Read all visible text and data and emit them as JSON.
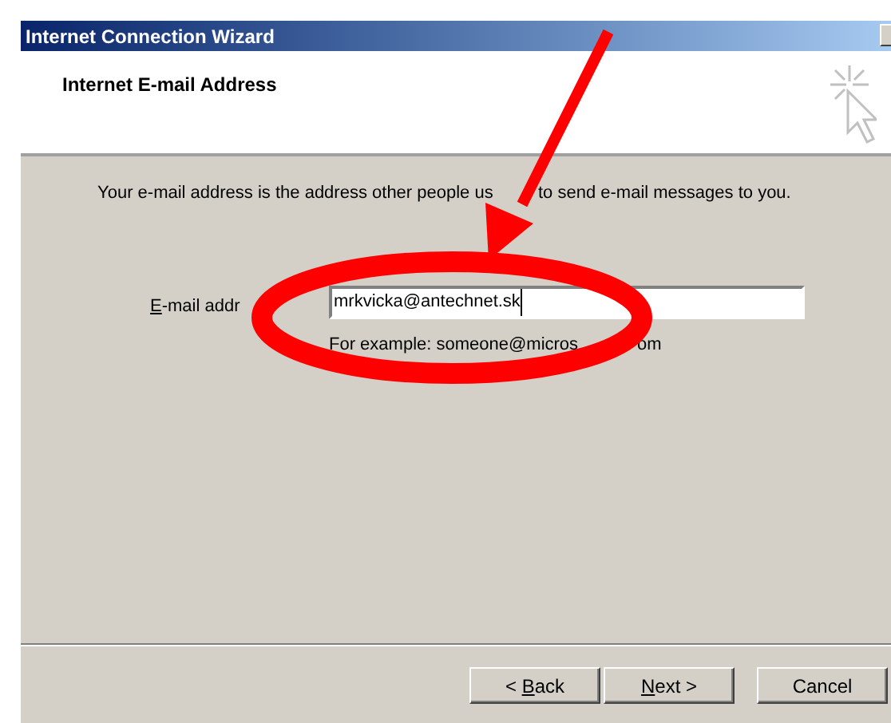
{
  "window": {
    "title": "Internet Connection Wizard"
  },
  "header": {
    "title": "Internet E-mail Address"
  },
  "description": {
    "parts": [
      "Your e-mail address is the address other people us",
      "to send e-mail messages to you."
    ]
  },
  "email_field": {
    "label": "E-mail addr",
    "label_key_first": true,
    "value": "mrkvicka@antechnet.sk",
    "example_parts": [
      "For example: someone@micros",
      "om"
    ]
  },
  "buttons": [
    {
      "before": "< ",
      "key": "B",
      "after": "ack"
    },
    {
      "key": "N",
      "after": "ext >"
    },
    {
      "after": "Cancel"
    }
  ]
}
